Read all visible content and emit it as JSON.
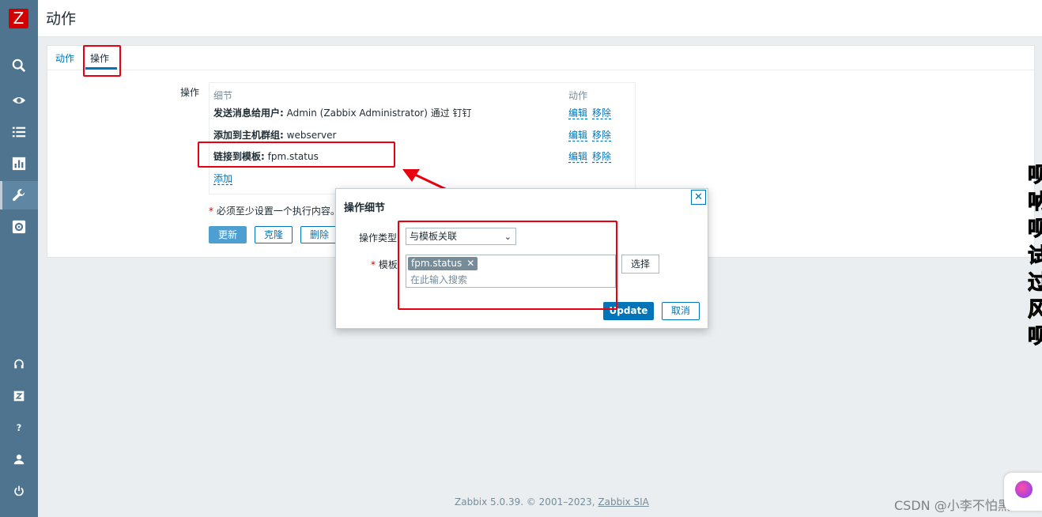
{
  "page": {
    "title": "动作"
  },
  "sidebar": {
    "logo": "Z",
    "icons": [
      "search-icon",
      "eye-icon",
      "list-icon",
      "chart-icon",
      "wrench-icon",
      "gear-icon",
      "headset-icon",
      "zabbix-share-icon",
      "help-icon",
      "user-icon",
      "power-icon"
    ]
  },
  "tabs": {
    "action": "动作",
    "operations": "操作"
  },
  "form": {
    "operations_label": "操作",
    "col_details": "细节",
    "col_action": "动作",
    "rows": [
      {
        "bold": "发送消息给用户:",
        "text": " Admin (Zabbix Administrator) 通过 钉钉",
        "edit": "编辑",
        "remove": "移除"
      },
      {
        "bold": "添加到主机群组:",
        "text": " webserver",
        "edit": "编辑",
        "remove": "移除"
      },
      {
        "bold": "链接到模板:",
        "text": " fpm.status",
        "edit": "编辑",
        "remove": "移除"
      }
    ],
    "add": "添加",
    "required_note": "必须至少设置一个执行内容。",
    "buttons": {
      "update": "更新",
      "clone": "克隆",
      "delete": "删除"
    }
  },
  "dialog": {
    "title": "操作细节",
    "close": "✕",
    "op_type_label": "操作类型",
    "op_type_value": "与模板关联",
    "template_label": "模板",
    "template_chip": "fpm.status",
    "search_placeholder": "在此输入搜索",
    "choose": "选择",
    "update": "Update",
    "cancel": "取消"
  },
  "footer": {
    "version": "Zabbix 5.0.39. © 2001–2023, ",
    "company": "Zabbix SIA"
  },
  "overlay": {
    "side_text": "呗呐呗试过风呗",
    "watermark": "CSDN @小李不怕黑"
  },
  "colors": {
    "sidebar": "#4f7490",
    "accent": "#0275b8",
    "annotation": "#e8000e"
  }
}
